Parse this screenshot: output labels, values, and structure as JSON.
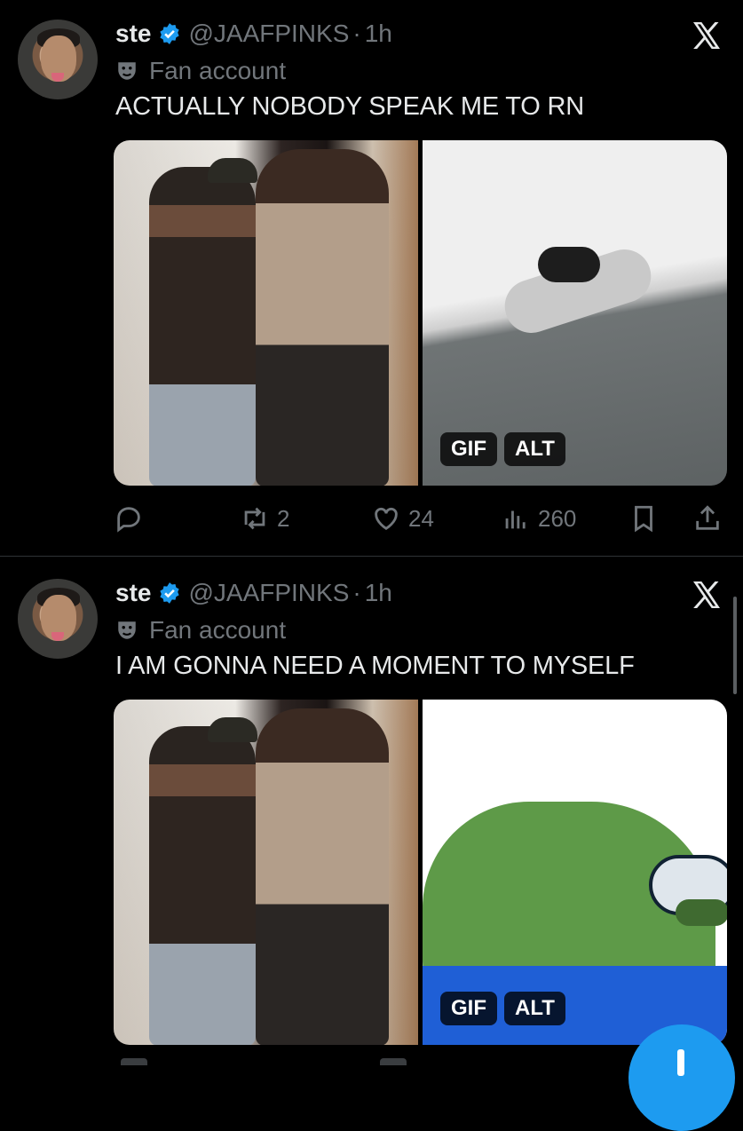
{
  "tweets": [
    {
      "name": "ste",
      "handle": "@JAAFPINKS",
      "separator": "·",
      "time": "1h",
      "label": "Fan account",
      "text": "ACTUALLY NOBODY SPEAK ME TO RN",
      "media_badges": [
        "GIF",
        "ALT"
      ],
      "stats": {
        "retweets": "2",
        "likes": "24",
        "views": "260"
      }
    },
    {
      "name": "ste",
      "handle": "@JAAFPINKS",
      "separator": "·",
      "time": "1h",
      "label": "Fan account",
      "text": "I AM GONNA NEED A MOMENT TO MYSELF",
      "media_badges": [
        "GIF",
        "ALT"
      ]
    }
  ],
  "colors": {
    "accent": "#1d9bf0",
    "background": "#000000",
    "muted": "#71767b"
  },
  "icons": [
    "verified-badge-icon",
    "theater-mask-icon",
    "x-logo-icon",
    "reply-icon",
    "retweet-icon",
    "like-icon",
    "views-icon",
    "bookmark-icon",
    "share-icon",
    "compose-plus-icon"
  ]
}
